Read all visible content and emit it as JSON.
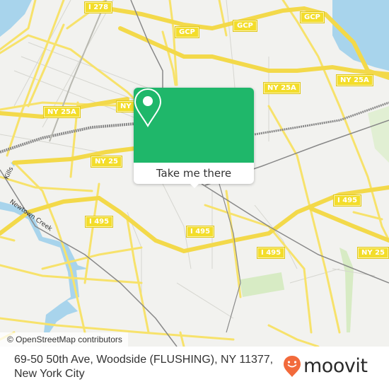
{
  "map": {
    "shields": [
      {
        "label": "I 278"
      },
      {
        "label": "GCP"
      },
      {
        "label": "GCP"
      },
      {
        "label": "GCP"
      },
      {
        "label": "NY 25A"
      },
      {
        "label": "NY 25A"
      },
      {
        "label": "NY 25A"
      },
      {
        "label": "NY"
      },
      {
        "label": "NY 25"
      },
      {
        "label": "I 495"
      },
      {
        "label": "I 495"
      },
      {
        "label": "I 495"
      },
      {
        "label": "I 495"
      },
      {
        "label": "NY 25"
      }
    ],
    "water_labels": {
      "newtown_creek": "Newtown Creek",
      "kills": "Kills"
    },
    "colors": {
      "land": "#f2f2ef",
      "road": "#f7e26b",
      "water": "#a8d4ec",
      "rail": "#777777",
      "park": "#d7ebc4"
    }
  },
  "popup": {
    "button_label": "Take me there",
    "accent": "#1fb76a"
  },
  "attribution": "© OpenStreetMap contributors",
  "footer": {
    "address_line1": "69-50 50th Ave, Woodside (FLUSHING), NY 11377,",
    "address_line2": "New York City",
    "brand": "moovit",
    "brand_color": "#f26a3b"
  }
}
